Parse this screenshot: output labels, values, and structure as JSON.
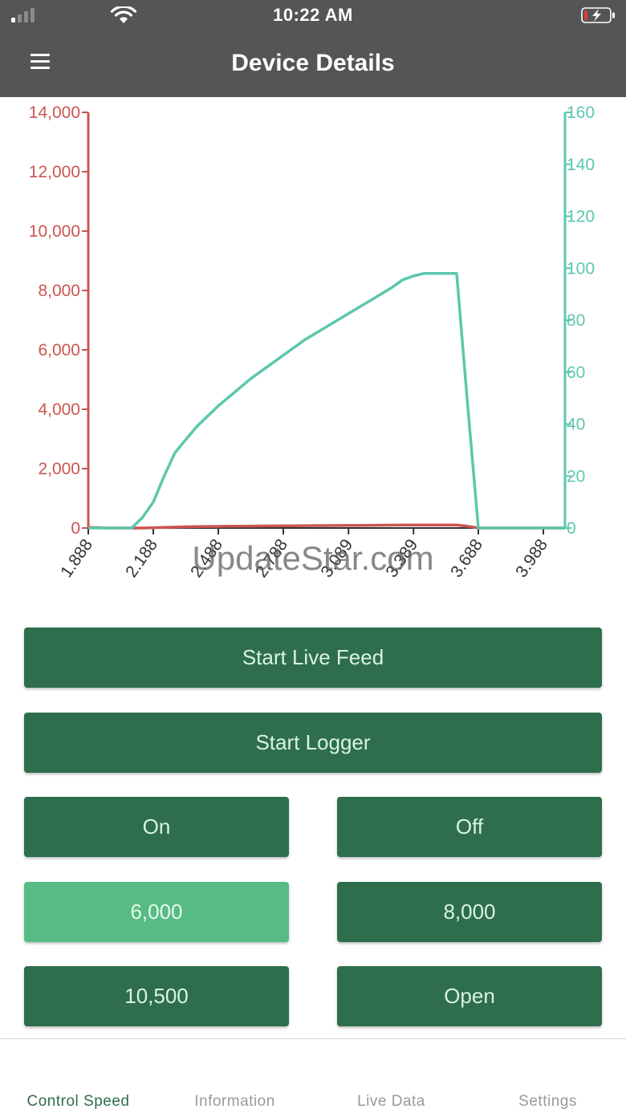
{
  "status_bar": {
    "time": "10:22 AM",
    "icons": [
      "cellular-signal-icon",
      "wifi-icon",
      "battery-charging-icon"
    ]
  },
  "nav": {
    "title": "Device Details",
    "menu_icon": "hamburger-menu-icon"
  },
  "colors": {
    "header": "#545557",
    "button": "#2e6e4c",
    "button_active": "#56bc83",
    "left_axis": "#cc5550",
    "right_axis": "#5cc7ad"
  },
  "chart_data": {
    "type": "line",
    "x": [
      1.888,
      1.938,
      1.988,
      2.038,
      2.088,
      2.138,
      2.188,
      2.238,
      2.288,
      2.338,
      2.388,
      2.438,
      2.488,
      2.538,
      2.588,
      2.638,
      2.688,
      2.738,
      2.788,
      2.838,
      2.888,
      2.938,
      2.988,
      3.038,
      3.088,
      3.138,
      3.188,
      3.238,
      3.288,
      3.338,
      3.388,
      3.438,
      3.488,
      3.538,
      3.588,
      3.638,
      3.688,
      3.738,
      3.788,
      3.838,
      3.888,
      3.938,
      3.988,
      4.038,
      4.088
    ],
    "xticks": [
      "1.888",
      "2.188",
      "2.488",
      "2.788",
      "3.089",
      "3.389",
      "3.688",
      "3.988"
    ],
    "left_axis": {
      "ylim": [
        0,
        14000
      ],
      "ticks": [
        "0",
        "2,000",
        "4,000",
        "6,000",
        "8,000",
        "10,000",
        "12,000",
        "14,000"
      ]
    },
    "right_axis": {
      "ylim": [
        0,
        160
      ],
      "ticks": [
        "0",
        "20",
        "40",
        "60",
        "80",
        "100",
        "120",
        "140",
        "160"
      ]
    },
    "series": [
      {
        "axis": "left",
        "color": "#cc5550",
        "values": [
          20,
          10,
          0,
          0,
          0,
          0,
          10,
          20,
          30,
          40,
          45,
          50,
          55,
          60,
          62,
          65,
          68,
          70,
          72,
          75,
          78,
          80,
          82,
          85,
          88,
          90,
          92,
          95,
          98,
          100,
          100,
          100,
          100,
          100,
          100,
          60,
          0,
          0,
          0,
          0,
          0,
          0,
          0,
          0,
          0
        ]
      },
      {
        "axis": "right",
        "color": "#5cc7ad",
        "values": [
          0,
          0,
          0,
          0,
          0,
          4,
          10,
          20,
          29,
          34,
          39,
          43,
          47,
          50.5,
          54,
          57.5,
          60.5,
          63.5,
          66.5,
          69.5,
          72.5,
          75,
          77.5,
          80,
          82.5,
          85,
          87.5,
          90,
          92.5,
          95.5,
          97,
          98,
          98,
          98,
          98,
          48,
          0,
          0,
          0,
          0,
          0,
          0,
          0,
          0,
          0
        ]
      }
    ]
  },
  "watermark": "UpdateStar.com",
  "buttons": {
    "live_feed": "Start Live Feed",
    "logger": "Start Logger",
    "on": "On",
    "off": "Off",
    "speed_6000": "6,000",
    "speed_8000": "8,000",
    "speed_10500": "10,500",
    "open": "Open"
  },
  "tabs": [
    {
      "label": "Control Speed",
      "selected": true
    },
    {
      "label": "Information",
      "selected": false
    },
    {
      "label": "Live Data",
      "selected": false
    },
    {
      "label": "Settings",
      "selected": false
    }
  ]
}
